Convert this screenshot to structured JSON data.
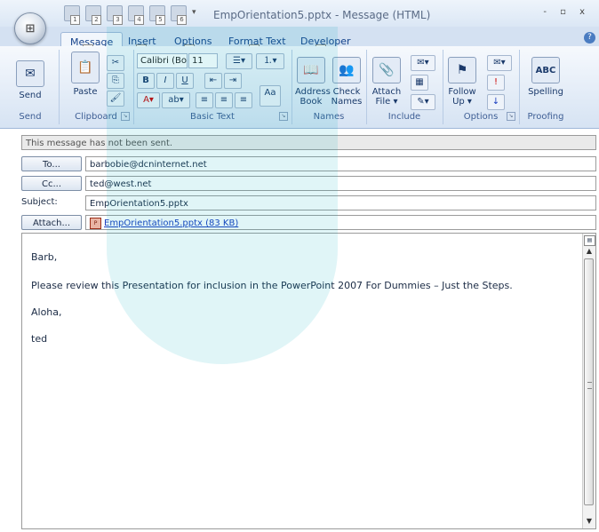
{
  "window": {
    "title": "EmpOrientation5.pptx - Message (HTML)",
    "controls": "- ▫ x"
  },
  "qat": {
    "items": [
      "1",
      "2",
      "3",
      "4",
      "5",
      "6"
    ]
  },
  "ribbon_tabs": [
    {
      "label": "Message",
      "keytip": "H"
    },
    {
      "label": "Insert",
      "keytip": "N"
    },
    {
      "label": "Options",
      "keytip": "P"
    },
    {
      "label": "Format Text",
      "keytip": "O"
    },
    {
      "label": "Developer",
      "keytip": "L"
    }
  ],
  "groups": {
    "send": {
      "label": "Send",
      "button": "Send"
    },
    "clipboard": {
      "label": "Clipboard",
      "paste": "Paste"
    },
    "basic_text": {
      "label": "Basic Text",
      "font_name": "Calibri (Bo",
      "font_size": "11",
      "bold": "B",
      "italic": "I",
      "underline": "U"
    },
    "names": {
      "label": "Names",
      "address_book_1": "Address",
      "address_book_2": "Book",
      "check_names_1": "Check",
      "check_names_2": "Names"
    },
    "include": {
      "label": "Include",
      "attach_file_1": "Attach",
      "attach_file_2": "File ▾"
    },
    "options": {
      "label": "Options",
      "follow_up_1": "Follow",
      "follow_up_2": "Up ▾"
    },
    "proofing": {
      "label": "Proofing",
      "spelling": "Spelling",
      "abc": "ABC"
    }
  },
  "message": {
    "status": "This message has not been sent.",
    "to_label": "To...",
    "to_value": "barbobie@dcninternet.net",
    "cc_label": "Cc...",
    "cc_value": "ted@west.net",
    "subject_label": "Subject:",
    "subject_value": "EmpOrientation5.pptx",
    "attach_label": "Attach...",
    "attachment": "EmpOrientation5.pptx (83 KB)"
  },
  "body": {
    "line1": "Barb,",
    "line2": "Please review this Presentation for inclusion in the PowerPoint 2007 For Dummies – Just the Steps.",
    "line3": "Aloha,",
    "line4": "ted"
  },
  "colors": {
    "ribbon": "#d6e3f3",
    "accent": "#15428b"
  }
}
